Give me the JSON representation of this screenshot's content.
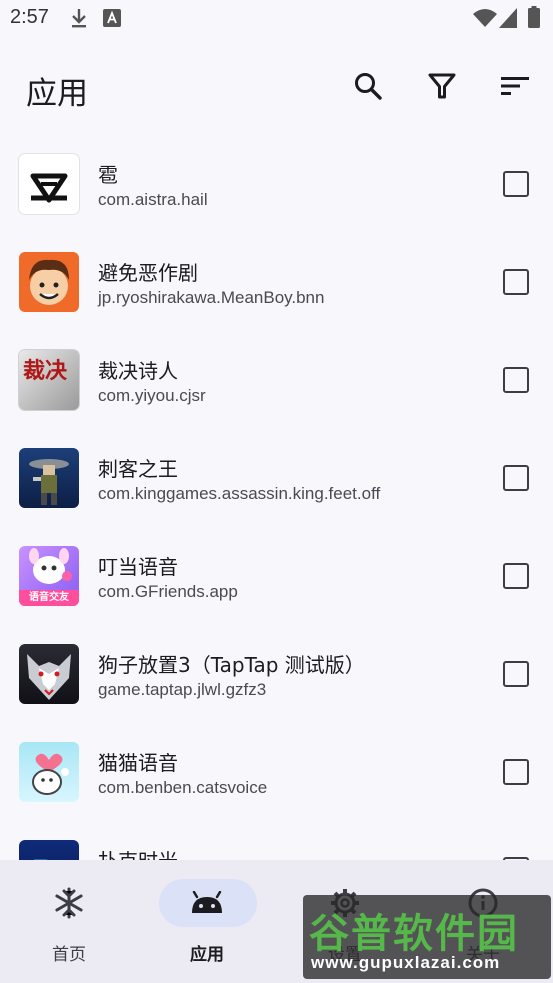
{
  "status": {
    "time": "2:57"
  },
  "header": {
    "title": "应用"
  },
  "apps": [
    {
      "name": "雹",
      "package": "com.aistra.hail"
    },
    {
      "name": "避免恶作剧",
      "package": "jp.ryoshirakawa.MeanBoy.bnn"
    },
    {
      "name": "裁决诗人",
      "package": "com.yiyou.cjsr",
      "icon_text": "裁决"
    },
    {
      "name": "刺客之王",
      "package": "com.kinggames.assassin.king.feet.off"
    },
    {
      "name": "叮当语音",
      "package": "com.GFriends.app",
      "icon_text": "语音交友"
    },
    {
      "name": "狗子放置3（TapTap 测试版）",
      "package": "game.taptap.jlwl.gzfz3"
    },
    {
      "name": "猫猫语音",
      "package": "com.benben.catsvoice"
    },
    {
      "name": "扑克时光",
      "package": ""
    }
  ],
  "nav": [
    {
      "label": "首页",
      "icon": "snowflake-icon",
      "active": false
    },
    {
      "label": "应用",
      "icon": "android-icon",
      "active": true
    },
    {
      "label": "设置",
      "icon": "gear-icon",
      "active": false
    },
    {
      "label": "关于",
      "icon": "info-icon",
      "active": false
    }
  ],
  "watermark": {
    "text": "谷普软件园",
    "url": "www.gupuxlazai.com"
  },
  "colors": {
    "background": "#f8f7fc",
    "nav_background": "#eceaf3",
    "nav_active_pill": "#dbe1f6",
    "watermark_green": "#56b74a"
  }
}
